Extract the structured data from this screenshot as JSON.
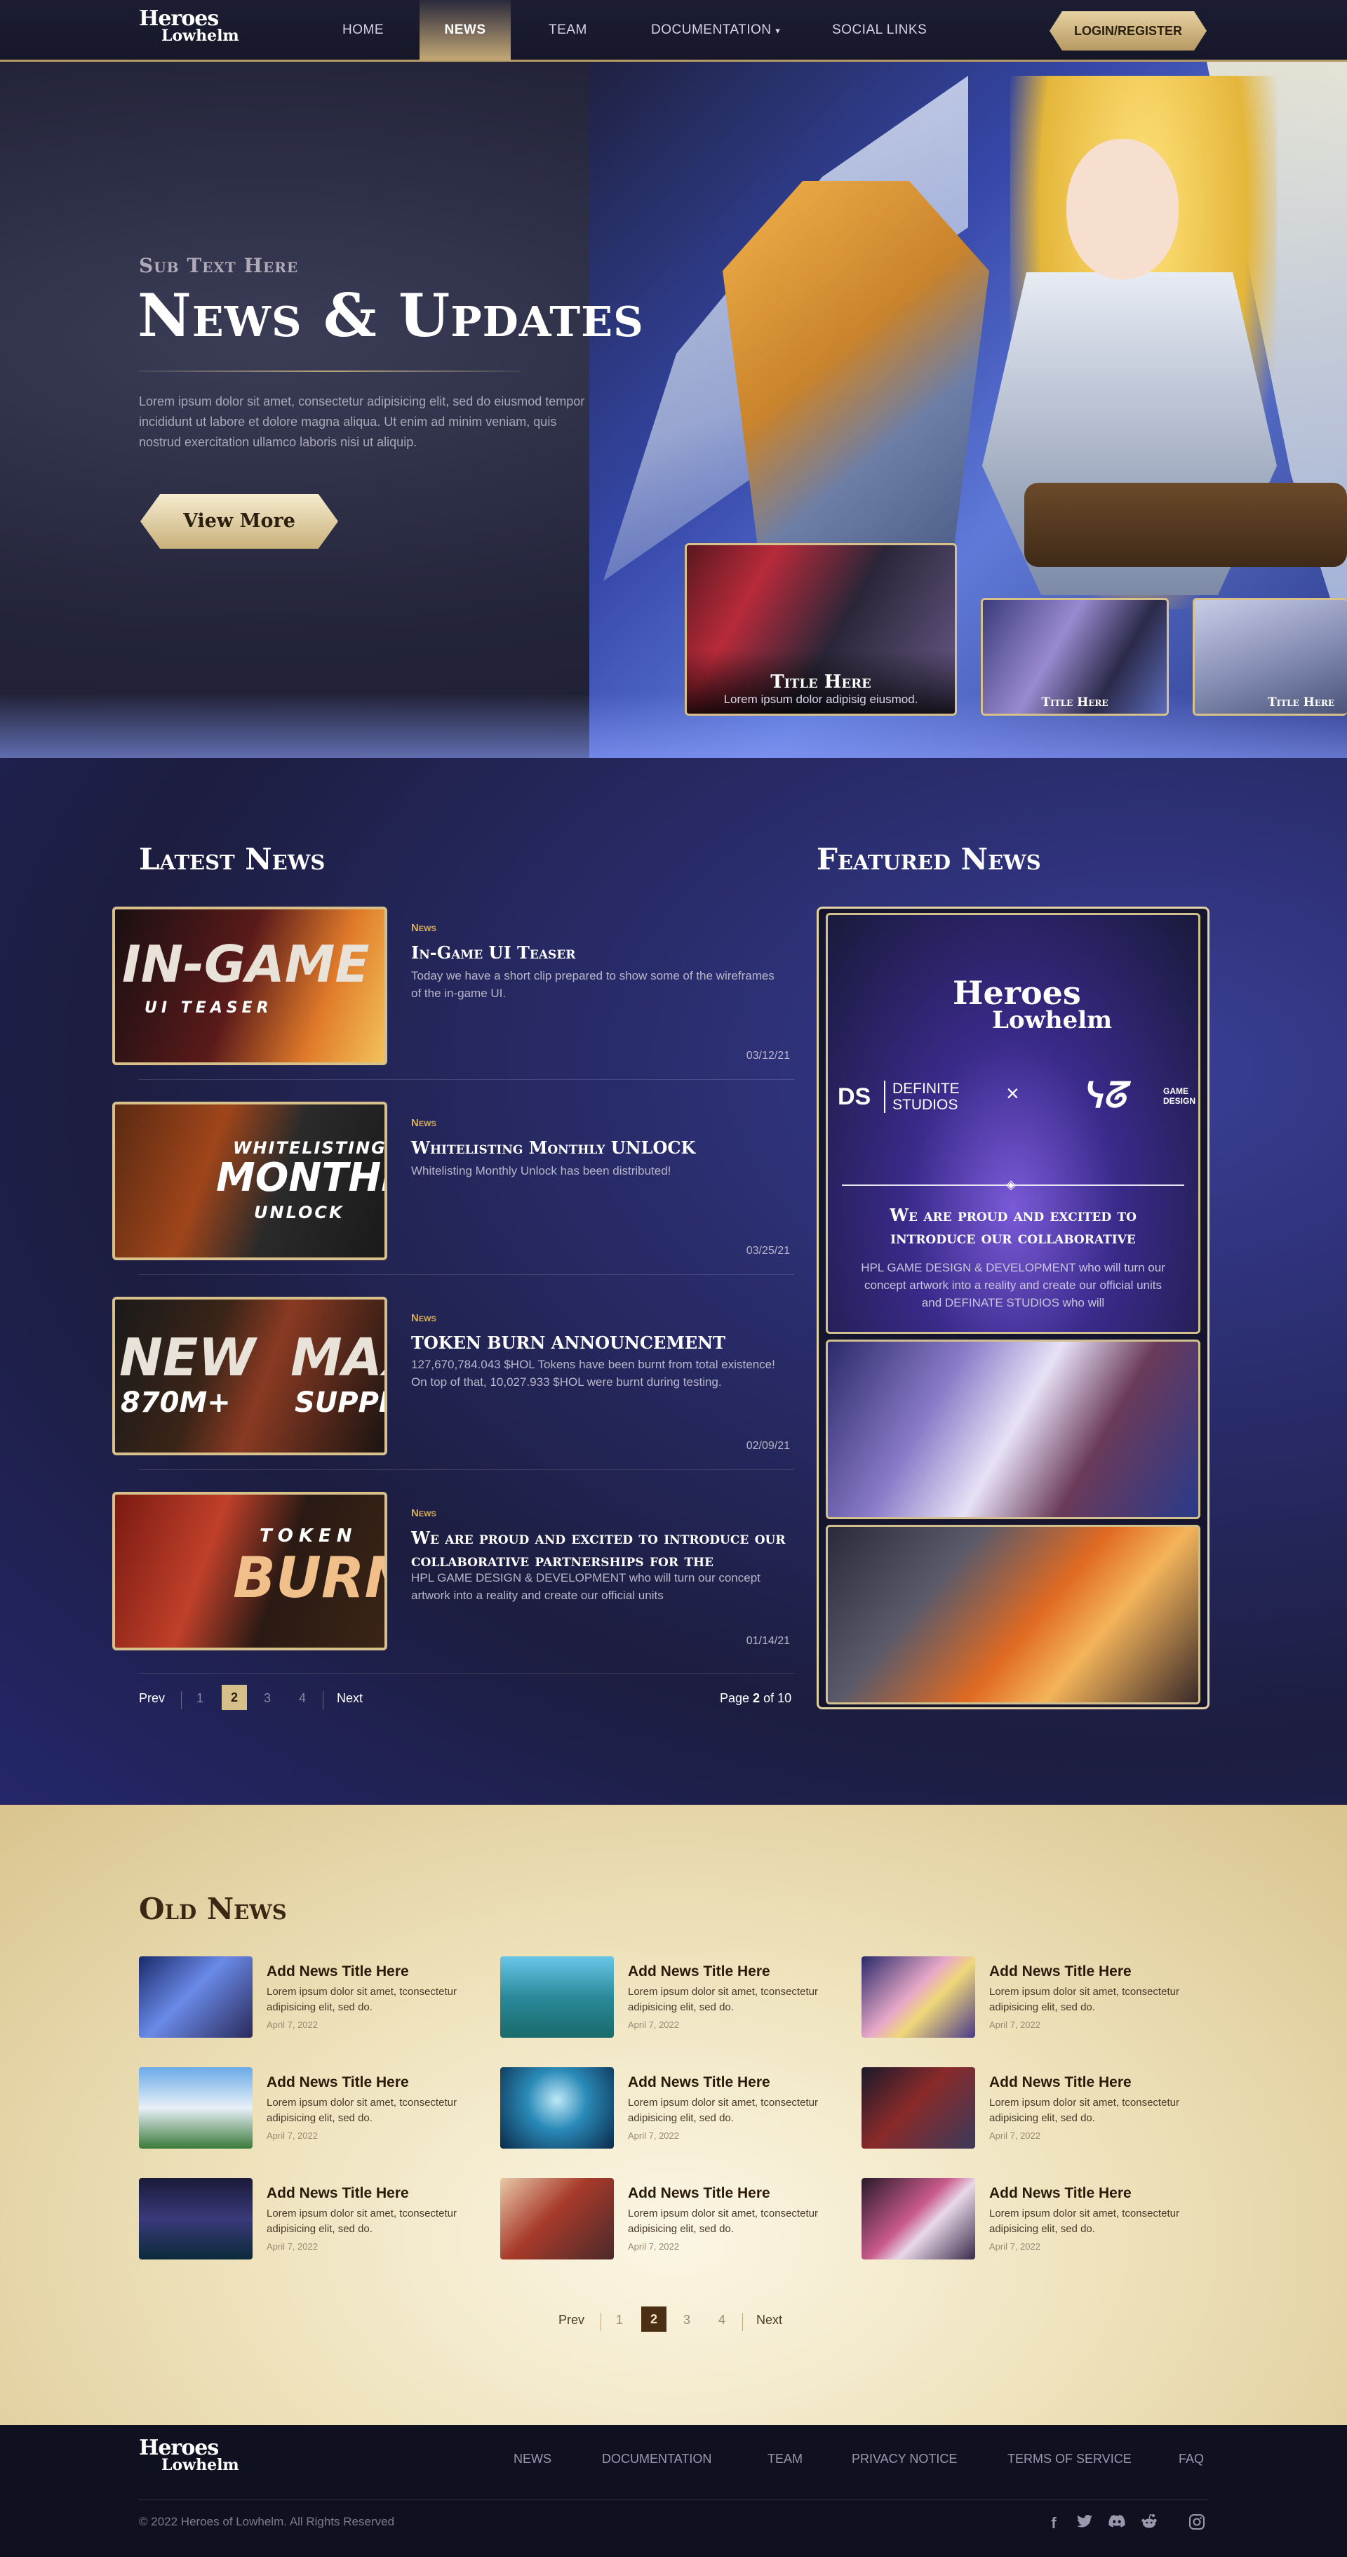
{
  "nav": {
    "logo_line1": "Heroes",
    "logo_line2": "Lowhelm",
    "items": [
      "HOME",
      "NEWS",
      "TEAM",
      "DOCUMENTATION",
      "SOCIAL LINKS"
    ],
    "login": "LOGIN/REGISTER"
  },
  "hero": {
    "sub": "Sub Text Here",
    "title": "News & Updates",
    "text": "Lorem ipsum dolor sit amet, consectetur adipisicing elit, sed do eiusmod tempor incididunt ut labore et dolore magna aliqua. Ut enim ad minim veniam, quis nostrud exercitation ullamco laboris nisi ut aliquip.",
    "button": "View More",
    "thumbs": [
      {
        "title": "Title Here",
        "desc": "Lorem ipsum dolor adipisig eiusmod."
      },
      {
        "title": "Title Here"
      },
      {
        "title": "Title Here"
      }
    ]
  },
  "latest": {
    "title": "Latest News",
    "items": [
      {
        "tag": "News",
        "title": "In-Game UI Teaser",
        "desc": "Today we have a short clip prepared to show some of the wireframes of the in-game UI.",
        "date": "03/12/21",
        "overlay1": "IN-GAME",
        "overlay2": "UI TEASER"
      },
      {
        "tag": "News",
        "title": "Whitelisting Monthly UNLOCK",
        "desc": "Whitelisting Monthly Unlock has been distributed!",
        "date": "03/25/21",
        "overlay1": "WHITELISTING",
        "overlay2": "MONTHLY",
        "overlay3": "UNLOCK"
      },
      {
        "tag": "News",
        "title": "TOKEN BURN ANNOUNCEMENT",
        "desc": "127,670,784.043 $HOL Tokens have been burnt from total existence! On top of that, 10,027.933 $HOL were burnt during testing.",
        "date": "02/09/21",
        "overlay1": "NEW",
        "overlay2": "MAX",
        "overlay3": "870M+",
        "overlay4": "SUPPLY"
      },
      {
        "tag": "News",
        "title": "We are proud and excited to introduce our collaborative partnerships for the",
        "desc": "HPL GAME DESIGN & DEVELOPMENT who will turn our concept artwork into a reality and create our official units",
        "date": "01/14/21",
        "overlay1": "TOKEN",
        "overlay2": "BURN"
      }
    ],
    "pager": {
      "prev": "Prev",
      "pages": [
        "1",
        "2",
        "3",
        "4"
      ],
      "next": "Next",
      "status_pre": "Page ",
      "status_cur": "2",
      "status_post": " of 10"
    }
  },
  "featured": {
    "title": "Featured News",
    "logo1": "Heroes",
    "logo2": "Lowhelm",
    "studio": "DEFINITE STUDIOS",
    "studio_short": "DS",
    "cross": "×",
    "game_design": "GAME DESIGN",
    "headline": "We are proud and excited to introduce our collaborative",
    "text": "HPL GAME DESIGN & DEVELOPMENT who will turn our concept artwork into a reality and create our official units and DEFINATE STUDIOS who will"
  },
  "old": {
    "title": "Old News",
    "items": [
      {
        "title": "Add News Title Here",
        "desc": "Lorem ipsum dolor sit amet, tconsectetur adipisicing elit, sed do.",
        "date": "April 7, 2022"
      },
      {
        "title": "Add News Title Here",
        "desc": "Lorem ipsum dolor sit amet, tconsectetur adipisicing elit, sed do.",
        "date": "April 7, 2022"
      },
      {
        "title": "Add News Title Here",
        "desc": "Lorem ipsum dolor sit amet, tconsectetur adipisicing elit, sed do.",
        "date": "April 7, 2022"
      },
      {
        "title": "Add News Title Here",
        "desc": "Lorem ipsum dolor sit amet, tconsectetur adipisicing elit, sed do.",
        "date": "April 7, 2022"
      },
      {
        "title": "Add News Title Here",
        "desc": "Lorem ipsum dolor sit amet, tconsectetur adipisicing elit, sed do.",
        "date": "April 7, 2022"
      },
      {
        "title": "Add News Title Here",
        "desc": "Lorem ipsum dolor sit amet, tconsectetur adipisicing elit, sed do.",
        "date": "April 7, 2022"
      },
      {
        "title": "Add News Title Here",
        "desc": "Lorem ipsum dolor sit amet, tconsectetur adipisicing elit, sed do.",
        "date": "April 7, 2022"
      },
      {
        "title": "Add News Title Here",
        "desc": "Lorem ipsum dolor sit amet, tconsectetur adipisicing elit, sed do.",
        "date": "April 7, 2022"
      },
      {
        "title": "Add News Title Here",
        "desc": "Lorem ipsum dolor sit amet, tconsectetur adipisicing elit, sed do.",
        "date": "April 7, 2022"
      }
    ],
    "pager": {
      "prev": "Prev",
      "pages": [
        "1",
        "2",
        "3",
        "4"
      ],
      "next": "Next"
    }
  },
  "footer": {
    "logo_line1": "Heroes",
    "logo_line2": "Lowhelm",
    "links": [
      "NEWS",
      "DOCUMENTATION",
      "TEAM",
      "PRIVACY NOTICE",
      "TERMS OF SERVICE",
      "FAQ"
    ],
    "copyright": "© 2022 Heroes of Lowhelm. All Rights Reserved",
    "social_icons": [
      "facebook-icon",
      "twitter-icon",
      "discord-icon",
      "reddit-icon",
      "instagram-icon"
    ]
  },
  "colors": {
    "gold": "#d8c08a",
    "navy": "#1c1d3f",
    "parchment": "#efe3bd"
  }
}
